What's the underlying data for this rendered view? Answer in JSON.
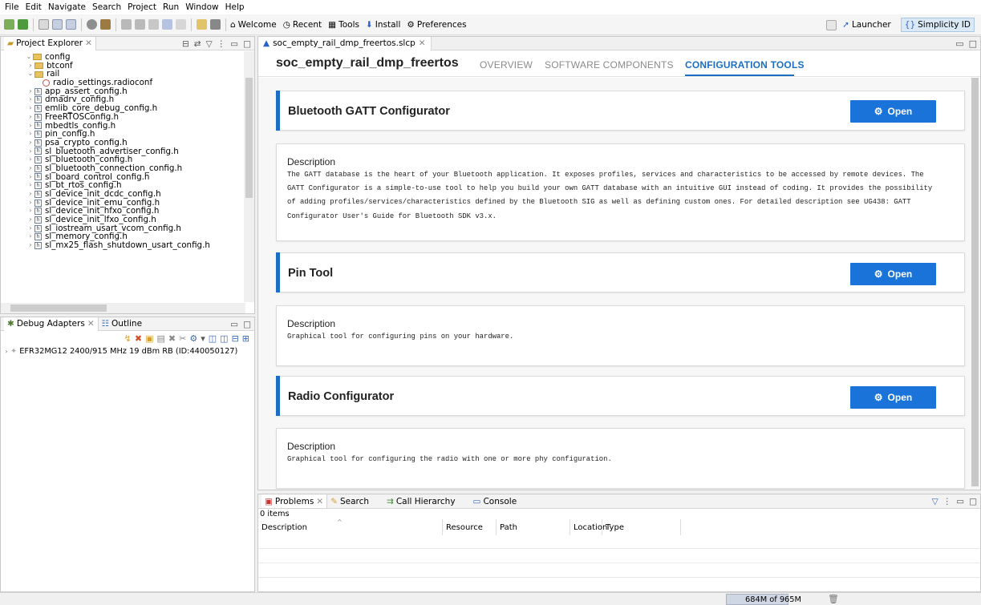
{
  "menubar": [
    "File",
    "Edit",
    "Navigate",
    "Search",
    "Project",
    "Run",
    "Window",
    "Help"
  ],
  "toolbar": {
    "welcome": "Welcome",
    "recent": "Recent",
    "tools": "Tools",
    "install": "Install",
    "preferences": "Preferences",
    "launcher": "Launcher",
    "simplicity": "Simplicity ID"
  },
  "project_explorer": {
    "title": "Project Explorer",
    "items": [
      {
        "label": "config",
        "type": "folder",
        "indent": 0,
        "expanded": true
      },
      {
        "label": "btconf",
        "type": "folder",
        "indent": 1,
        "expanded": false
      },
      {
        "label": "rail",
        "type": "folder",
        "indent": 1,
        "expanded": true
      },
      {
        "label": "radio_settings.radioconf",
        "type": "radio",
        "indent": 2
      },
      {
        "label": "app_assert_config.h",
        "type": "file",
        "indent": 1
      },
      {
        "label": "dmadrv_config.h",
        "type": "file",
        "indent": 1
      },
      {
        "label": "emlib_core_debug_config.h",
        "type": "file",
        "indent": 1
      },
      {
        "label": "FreeRTOSConfig.h",
        "type": "file",
        "indent": 1
      },
      {
        "label": "mbedtls_config.h",
        "type": "file",
        "indent": 1
      },
      {
        "label": "pin_config.h",
        "type": "file",
        "indent": 1
      },
      {
        "label": "psa_crypto_config.h",
        "type": "file",
        "indent": 1
      },
      {
        "label": "sl_bluetooth_advertiser_config.h",
        "type": "file",
        "indent": 1
      },
      {
        "label": "sl_bluetooth_config.h",
        "type": "file",
        "indent": 1
      },
      {
        "label": "sl_bluetooth_connection_config.h",
        "type": "file",
        "indent": 1
      },
      {
        "label": "sl_board_control_config.h",
        "type": "file",
        "indent": 1
      },
      {
        "label": "sl_bt_rtos_config.h",
        "type": "file",
        "indent": 1
      },
      {
        "label": "sl_device_init_dcdc_config.h",
        "type": "file",
        "indent": 1
      },
      {
        "label": "sl_device_init_emu_config.h",
        "type": "file",
        "indent": 1
      },
      {
        "label": "sl_device_init_hfxo_config.h",
        "type": "file",
        "indent": 1
      },
      {
        "label": "sl_device_init_lfxo_config.h",
        "type": "file",
        "indent": 1
      },
      {
        "label": "sl_iostream_usart_vcom_config.h",
        "type": "file",
        "indent": 1
      },
      {
        "label": "sl_memory_config.h",
        "type": "file",
        "indent": 1
      },
      {
        "label": "sl_mx25_flash_shutdown_usart_config.h",
        "type": "file",
        "indent": 1
      }
    ]
  },
  "debug_panel": {
    "tab_debug": "Debug Adapters",
    "tab_outline": "Outline",
    "device": "EFR32MG12 2400/915 MHz 19 dBm RB (ID:440050127)"
  },
  "editor": {
    "tab_label": "soc_empty_rail_dmp_freertos.slcp",
    "project_title": "soc_empty_rail_dmp_freertos",
    "nav": [
      "OVERVIEW",
      "SOFTWARE COMPONENTS",
      "CONFIGURATION TOOLS"
    ],
    "active_nav": "CONFIGURATION TOOLS",
    "open_label": "Open",
    "description_label": "Description",
    "tools": [
      {
        "title": "Bluetooth GATT Configurator",
        "description_lines": [
          "The GATT database is the heart of your Bluetooth application. It exposes profiles, services and characteristics to be accessed by remote devices. The",
          "GATT Configurator is a simple-to-use tool to help you build your own GATT database with an intuitive GUI instead of coding. It provides the possibility",
          "of adding profiles/services/characteristics defined by the Bluetooth SIG as well as defining custom ones. For detailed description see UG438: GATT",
          "Configurator User's Guide for Bluetooth SDK v3.x."
        ]
      },
      {
        "title": "Pin Tool",
        "description_lines": [
          "Graphical tool for configuring pins on your hardware."
        ]
      },
      {
        "title": "Radio Configurator",
        "description_lines": [
          "Graphical tool for configuring the radio with one or more phy configuration."
        ]
      }
    ]
  },
  "problems": {
    "tabs": [
      "Problems",
      "Search",
      "Call Hierarchy",
      "Console"
    ],
    "count": "0 items",
    "columns": [
      "Description",
      "Resource",
      "Path",
      "Location",
      "Type"
    ]
  },
  "status": {
    "heap": "684M of 965M",
    "heap_used_fraction": 0.709
  }
}
